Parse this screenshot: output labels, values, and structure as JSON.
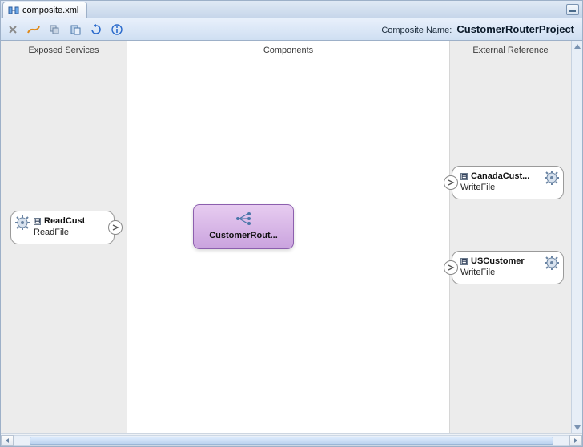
{
  "tab": {
    "label": "composite.xml"
  },
  "toolbar": {
    "compositeNameLabel": "Composite Name:",
    "compositeNameValue": "CustomerRouterProject"
  },
  "lanes": {
    "exposed": "Exposed Services",
    "components": "Components",
    "external": "External Reference"
  },
  "nodes": {
    "readCust": {
      "title": "ReadCust",
      "subtitle": "ReadFile"
    },
    "customerRouter": {
      "label": "CustomerRout..."
    },
    "canadaCust": {
      "title": "CanadaCust...",
      "subtitle": "WriteFile"
    },
    "usCustomer": {
      "title": "USCustomer",
      "subtitle": "WriteFile"
    }
  },
  "glyphs": {
    "collapse": "⊟"
  }
}
